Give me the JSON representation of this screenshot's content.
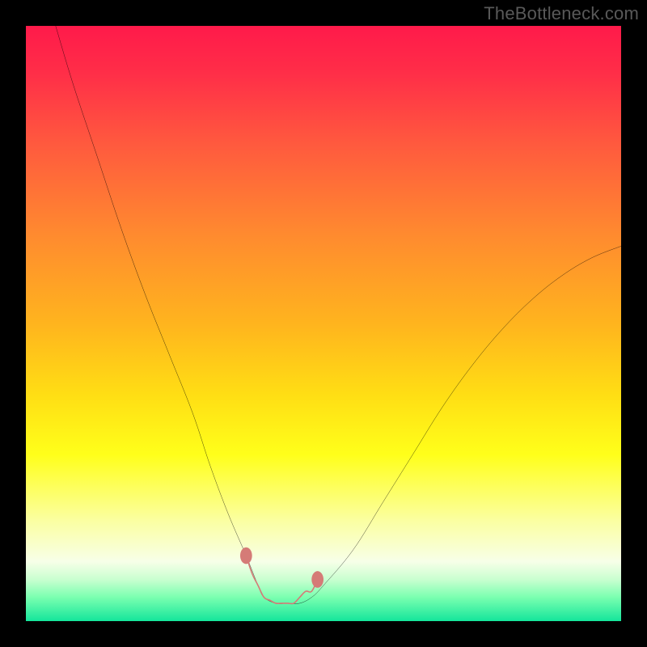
{
  "watermark": "TheBottleneck.com",
  "colors": {
    "frame": "#000000",
    "watermark": "#595959",
    "curve": "#000000",
    "marks": "#d57b77",
    "gradient_stops": [
      {
        "offset": 0.0,
        "color": "#ff1a4a"
      },
      {
        "offset": 0.08,
        "color": "#ff2e48"
      },
      {
        "offset": 0.2,
        "color": "#ff5a3e"
      },
      {
        "offset": 0.35,
        "color": "#ff8a2f"
      },
      {
        "offset": 0.5,
        "color": "#ffb41e"
      },
      {
        "offset": 0.62,
        "color": "#ffde14"
      },
      {
        "offset": 0.72,
        "color": "#ffff1a"
      },
      {
        "offset": 0.83,
        "color": "#fbffa0"
      },
      {
        "offset": 0.9,
        "color": "#f7ffe8"
      },
      {
        "offset": 0.93,
        "color": "#c9ffd0"
      },
      {
        "offset": 0.96,
        "color": "#7affb0"
      },
      {
        "offset": 1.0,
        "color": "#14e59b"
      }
    ]
  },
  "chart_data": {
    "type": "line",
    "title": "",
    "xlabel": "",
    "ylabel": "",
    "xlim": [
      0,
      100
    ],
    "ylim": [
      0,
      100
    ],
    "grid": false,
    "series": [
      {
        "name": "bottleneck-curve",
        "x": [
          5,
          8,
          12,
          16,
          20,
          24,
          28,
          31,
          34,
          37,
          39,
          40,
          42,
          44,
          46,
          48,
          50,
          55,
          60,
          65,
          70,
          75,
          80,
          85,
          90,
          95,
          100
        ],
        "values": [
          100,
          90,
          78,
          66,
          55,
          45,
          35,
          26,
          18,
          11,
          6,
          4,
          3,
          3,
          3,
          4,
          6,
          12,
          20,
          28,
          36,
          43,
          49,
          54,
          58,
          61,
          63
        ]
      }
    ],
    "annotations": {
      "optimal_segment": {
        "x": [
          37,
          38,
          39,
          40,
          41,
          42,
          43,
          44,
          45,
          46,
          47,
          48,
          49
        ],
        "values": [
          11,
          8,
          6,
          4,
          3.5,
          3,
          3,
          3,
          3,
          4,
          5,
          5,
          7
        ]
      },
      "optimal_endpoints": [
        {
          "x": 37,
          "y": 11
        },
        {
          "x": 49,
          "y": 7
        }
      ]
    }
  }
}
